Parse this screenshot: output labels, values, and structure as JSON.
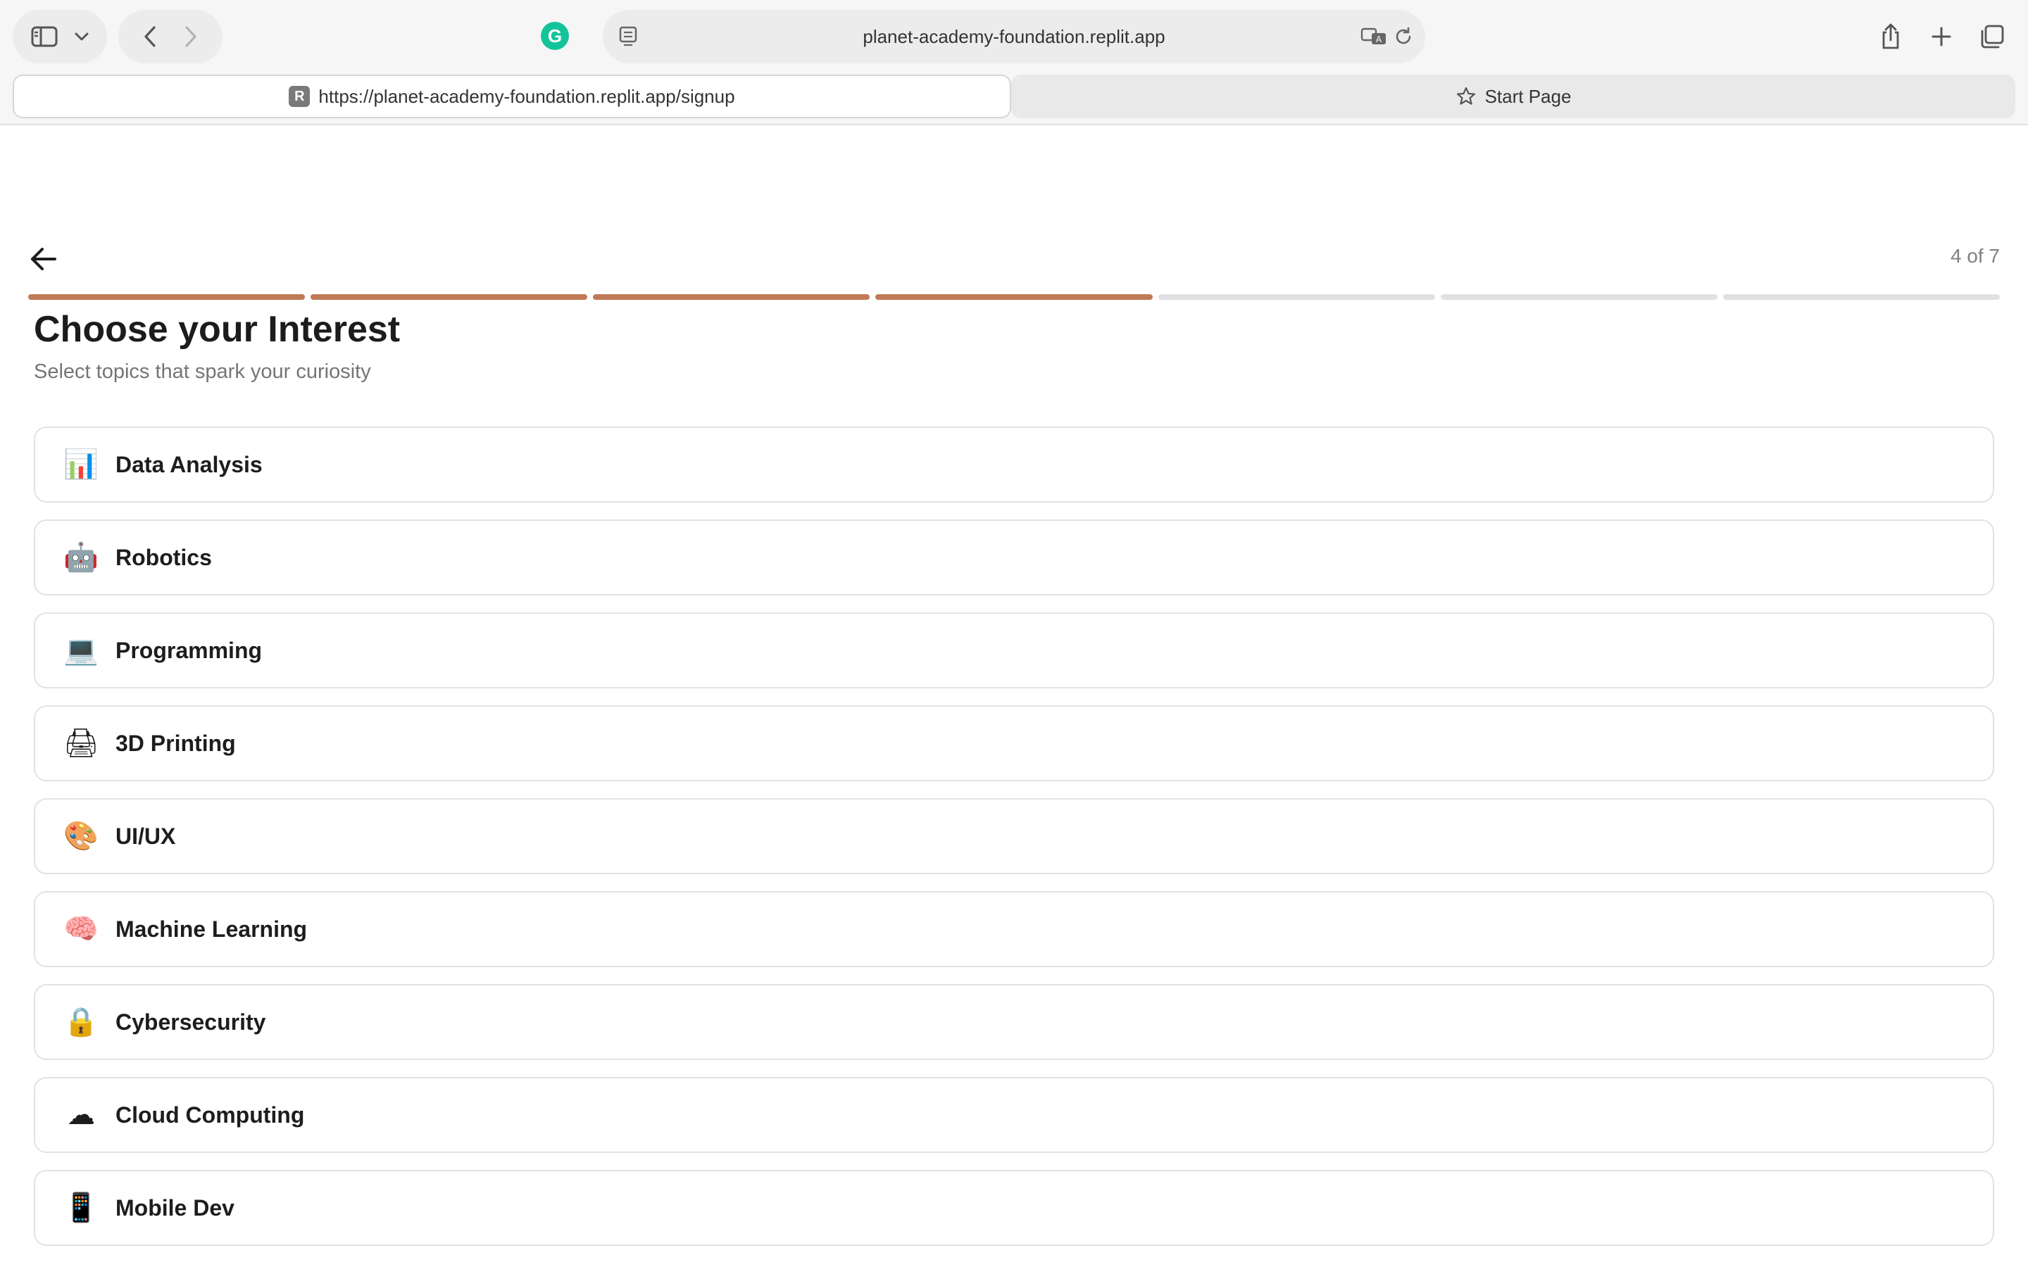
{
  "browser": {
    "address_host": "planet-academy-foundation.replit.app",
    "grammarly_letter": "G",
    "active_tab": {
      "favicon_letter": "R",
      "url": "https://planet-academy-foundation.replit.app/signup"
    },
    "inactive_tab": {
      "label": "Start Page"
    }
  },
  "page": {
    "step_indicator": "4 of 7",
    "progress": {
      "total_steps": 7,
      "completed_steps": 4
    },
    "title": "Choose your Interest",
    "subtitle": "Select topics that spark your curiosity",
    "interests": [
      {
        "icon": "📊",
        "icon_name": "bar-chart-icon",
        "label": "Data Analysis"
      },
      {
        "icon": "🤖",
        "icon_name": "robot-icon",
        "label": "Robotics"
      },
      {
        "icon": "💻",
        "icon_name": "laptop-icon",
        "label": "Programming"
      },
      {
        "icon": "🖨",
        "icon_name": "printer-icon",
        "label": "3D Printing"
      },
      {
        "icon": "🎨",
        "icon_name": "palette-icon",
        "label": "UI/UX"
      },
      {
        "icon": "🧠",
        "icon_name": "brain-icon",
        "label": "Machine Learning"
      },
      {
        "icon": "🔒",
        "icon_name": "lock-icon",
        "label": "Cybersecurity"
      },
      {
        "icon": "☁",
        "icon_name": "cloud-icon",
        "label": "Cloud Computing"
      },
      {
        "icon": "📱",
        "icon_name": "mobile-phone-icon",
        "label": "Mobile Dev"
      }
    ]
  },
  "colors": {
    "progress_done": "#c07a57",
    "progress_todo": "#e1e1e1",
    "card_border": "#e2e2e2"
  }
}
